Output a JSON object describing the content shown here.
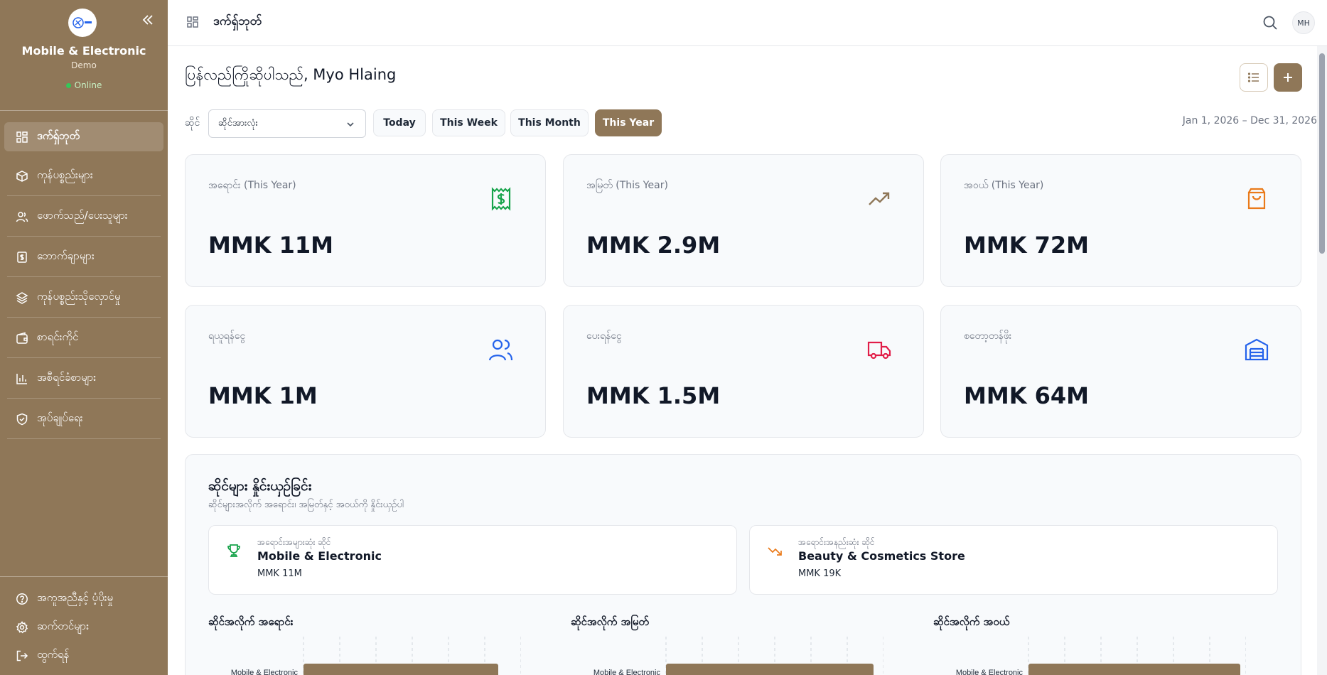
{
  "sidebar": {
    "brand": "Mobile & Electronic",
    "subbrand": "Demo",
    "status": "Online",
    "items": [
      {
        "label": "ဒက်ရှ်ဘုတ်",
        "icon": "dashboard-icon",
        "active": true
      },
      {
        "label": "ကုန်ပစ္စည်းများ",
        "icon": "box-icon",
        "active": false
      },
      {
        "label": "ဖောက်သည်/ပေးသူများ",
        "icon": "users-icon",
        "active": false
      },
      {
        "label": "ဘောက်ချာများ",
        "icon": "receipt-icon",
        "active": false
      },
      {
        "label": "ကုန်ပစ္စည်းသိုလှောင်မှု",
        "icon": "layers-icon",
        "active": false
      },
      {
        "label": "စာရင်းကိုင်",
        "icon": "wallet-icon",
        "active": false
      },
      {
        "label": "အစီရင်ခံစာများ",
        "icon": "bar-chart-icon",
        "active": false
      },
      {
        "label": "အုပ်ချုပ်ရေး",
        "icon": "shield-icon",
        "active": false
      }
    ],
    "bottom_items": [
      {
        "label": "အကူအညီနှင့် ပံ့ပိုးမှု",
        "icon": "help-icon"
      },
      {
        "label": "ဆက်တင်များ",
        "icon": "gear-icon"
      },
      {
        "label": "ထွက်ရန်",
        "icon": "logout-icon"
      }
    ]
  },
  "header": {
    "title": "ဒက်ရှ်ဘုတ်",
    "avatar": "MH"
  },
  "main": {
    "greeting": "ပြန်လည်ကြိုဆိုပါသည်, Myo Hlaing",
    "filter_label": "ဆိုင်",
    "store_select": "ဆိုင်အားလုံး",
    "periods": [
      {
        "label": "Today",
        "active": false
      },
      {
        "label": "This Week",
        "active": false
      },
      {
        "label": "This Month",
        "active": false
      },
      {
        "label": "This Year",
        "active": true
      }
    ],
    "date_range": "Jan 1, 2026 – Dec 31, 2026",
    "cards": [
      {
        "label": "အရောင်း (This Year)",
        "value": "MMK 11M",
        "icon": "dollar-receipt-icon",
        "color": "#16a34a"
      },
      {
        "label": "အမြတ် (This Year)",
        "value": "MMK 2.9M",
        "icon": "trending-up-icon",
        "color": "#8f7758"
      },
      {
        "label": "အဝယ် (This Year)",
        "value": "MMK 72M",
        "icon": "shopping-bag-icon",
        "color": "#ea7a1a"
      },
      {
        "label": "ရယူရန်ငွေ",
        "value": "MMK 1M",
        "icon": "users-icon",
        "color": "#2563eb"
      },
      {
        "label": "ပေးရန်ငွေ",
        "value": "MMK 1.5M",
        "icon": "truck-icon",
        "color": "#e11d48"
      },
      {
        "label": "စတော့တန်ဖိုး",
        "value": "MMK 64M",
        "icon": "warehouse-icon",
        "color": "#2563eb"
      }
    ],
    "performance": {
      "title": "ဆိုင်များ နှိုင်းယှဉ်ခြင်း",
      "subtitle": "ဆိုင်များအလိုက် အရောင်း၊ အမြတ်နှင့် အဝယ်ကို နှိုင်းယှဉ်ပါ",
      "top_store": {
        "caption": "အရောင်းအများဆုံး ဆိုင်",
        "name": "Mobile & Electronic",
        "value": "MMK 11M",
        "icon": "trophy-icon"
      },
      "low_store": {
        "caption": "အရောင်းအနည်းဆုံး ဆိုင်",
        "name": "Beauty & Cosmetics Store",
        "value": "MMK 19K",
        "icon": "trending-down-icon"
      },
      "charts": [
        {
          "title": "ဆိုင်အလိုက် အရောင်း",
          "bar_label": "Mobile & Electronic"
        },
        {
          "title": "ဆိုင်အလိုက် အမြတ်",
          "bar_label": "Mobile & Electronic"
        },
        {
          "title": "ဆိုင်အလိုက် အဝယ်",
          "bar_label": "Mobile & Electronic"
        }
      ]
    }
  },
  "colors": {
    "brand": "#8f7758",
    "success": "#16a34a",
    "danger": "#e11d48",
    "info": "#2563eb",
    "warning": "#ea7a1a"
  }
}
